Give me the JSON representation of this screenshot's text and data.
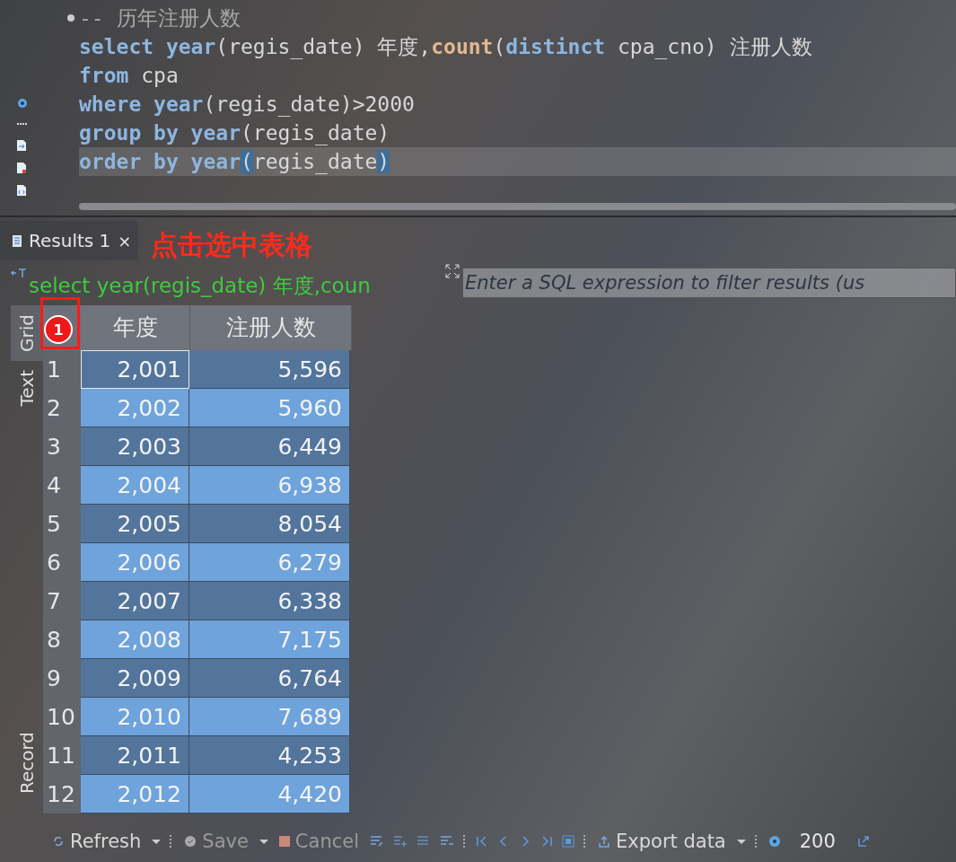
{
  "editor": {
    "comment": "-- 历年注册人数",
    "lines": [
      {
        "current": false,
        "tokens": [
          {
            "kind": "keyword",
            "text": "select year"
          },
          {
            "kind": "plain",
            "text": "(regis_date) 年度,"
          },
          {
            "kind": "function",
            "text": "count"
          },
          {
            "kind": "plain",
            "text": "("
          },
          {
            "kind": "keyword",
            "text": "distinct"
          },
          {
            "kind": "plain",
            "text": " cpa_cno) 注册人数"
          }
        ]
      },
      {
        "current": false,
        "tokens": [
          {
            "kind": "keyword",
            "text": "from"
          },
          {
            "kind": "plain",
            "text": " cpa"
          }
        ]
      },
      {
        "current": false,
        "tokens": [
          {
            "kind": "keyword",
            "text": "where year"
          },
          {
            "kind": "plain",
            "text": "(regis_date)>2000"
          }
        ]
      },
      {
        "current": false,
        "tokens": [
          {
            "kind": "keyword",
            "text": "group by year"
          },
          {
            "kind": "plain",
            "text": "(regis_date)"
          }
        ]
      },
      {
        "current": true,
        "tokens": [
          {
            "kind": "keyword",
            "text": "order by year"
          },
          {
            "kind": "match",
            "text": "("
          },
          {
            "kind": "plain",
            "text": "regis_date"
          },
          {
            "kind": "match",
            "text": ")"
          }
        ]
      }
    ]
  },
  "results_tab": {
    "label": "Results 1",
    "close": "×"
  },
  "query_label": "select year(regis_date) 年度,coun",
  "filter": {
    "placeholder": "Enter a SQL expression to filter results (us"
  },
  "side_tabs": [
    {
      "label": "Grid",
      "selected": true
    },
    {
      "label": "Text",
      "selected": false
    },
    {
      "label": "Record",
      "selected": false
    }
  ],
  "grid": {
    "columns": [
      "年度",
      "注册人数"
    ],
    "rows": [
      {
        "num": "1",
        "cells": [
          "2,001",
          "5,596"
        ],
        "focused": true
      },
      {
        "num": "2",
        "cells": [
          "2,002",
          "5,960"
        ],
        "focused": false
      },
      {
        "num": "3",
        "cells": [
          "2,003",
          "6,449"
        ],
        "focused": false
      },
      {
        "num": "4",
        "cells": [
          "2,004",
          "6,938"
        ],
        "focused": false
      },
      {
        "num": "5",
        "cells": [
          "2,005",
          "8,054"
        ],
        "focused": false
      },
      {
        "num": "6",
        "cells": [
          "2,006",
          "6,279"
        ],
        "focused": false
      },
      {
        "num": "7",
        "cells": [
          "2,007",
          "6,338"
        ],
        "focused": false
      },
      {
        "num": "8",
        "cells": [
          "2,008",
          "7,175"
        ],
        "focused": false
      },
      {
        "num": "9",
        "cells": [
          "2,009",
          "6,764"
        ],
        "focused": false
      },
      {
        "num": "10",
        "cells": [
          "2,010",
          "7,689"
        ],
        "focused": false
      },
      {
        "num": "11",
        "cells": [
          "2,011",
          "4,253"
        ],
        "focused": false
      },
      {
        "num": "12",
        "cells": [
          "2,012",
          "4,420"
        ],
        "focused": false
      }
    ]
  },
  "annotation": {
    "text": "点击选中表格",
    "badge": "1"
  },
  "toolbar": {
    "refresh": "Refresh",
    "save": {
      "label": "Save",
      "disabled": true
    },
    "cancel": {
      "label": "Cancel",
      "disabled": true
    },
    "export": "Export data",
    "fetch_size": "200"
  }
}
